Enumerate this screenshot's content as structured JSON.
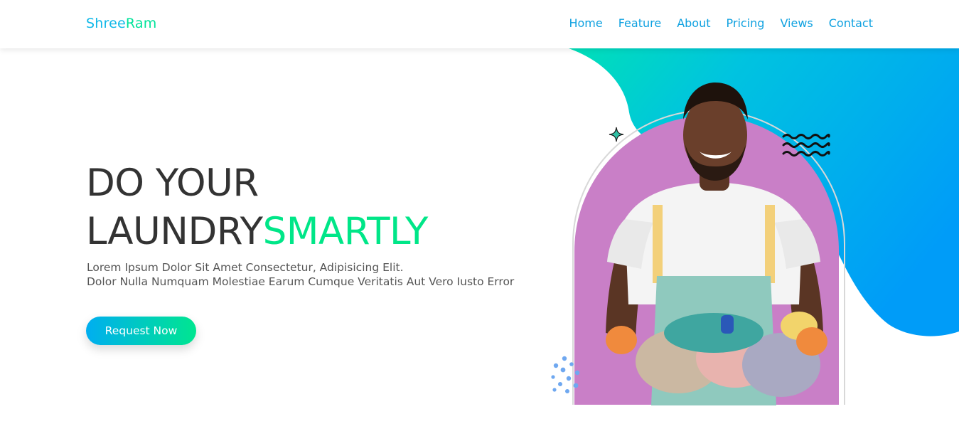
{
  "header": {
    "logo": {
      "part1": "Shree",
      "part2": "Ram"
    },
    "nav": [
      "Home",
      "Feature",
      "About",
      "Pricing",
      "Views",
      "Contact"
    ]
  },
  "hero": {
    "title_line1": "DO YOUR",
    "title_line2_main": "LAUNDRY",
    "title_line2_accent": "SMARTLY",
    "description_line1": "Lorem Ipsum Dolor Sit Amet Consectetur, Adipisicing Elit.",
    "description_line2": "Dolor Nulla Numquam Molestiae Earum Cumque Veritatis Aut Vero Iusto Error",
    "cta_label": "Request Now"
  },
  "colors": {
    "brand_blue": "#0fa1e0",
    "brand_green": "#00e688",
    "title_text": "#333333",
    "arch_purple": "#c97fc7"
  }
}
